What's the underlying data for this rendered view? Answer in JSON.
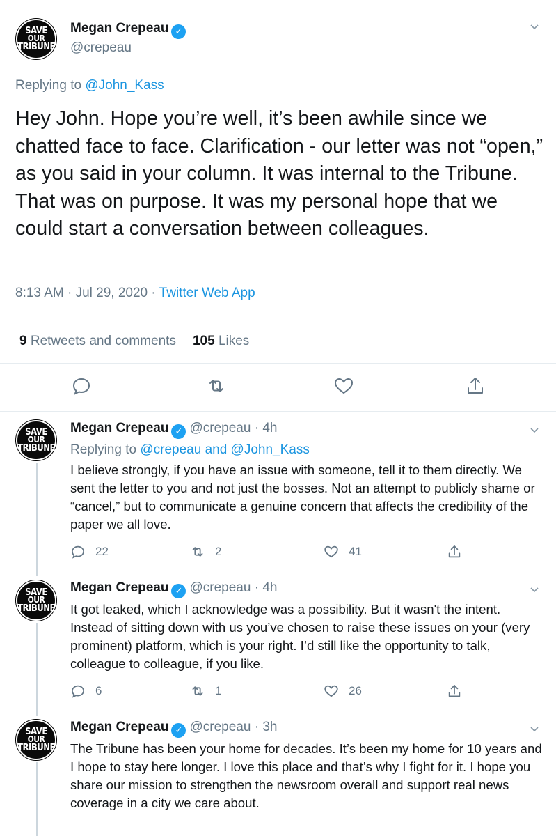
{
  "main_tweet": {
    "avatar_lines": [
      "SAVE",
      "OUR",
      "TRIBUNE"
    ],
    "name": "Megan Crepeau",
    "handle": "@crepeau",
    "replying_prefix": "Replying to ",
    "replying_to": "@John_Kass",
    "text": "Hey John. Hope you’re well, it’s been awhile since we chatted face to face. Clarification - our letter was not “open,” as you said in your column. It was internal to the Tribune. That was on purpose. It was my personal hope that we could start a conversation between colleagues.",
    "timestamp": "8:13 AM · Jul 29, 2020 · ",
    "source": "Twitter Web App",
    "retweets_count": "9",
    "retweets_label": "Retweets and comments",
    "likes_count": "105",
    "likes_label": "Likes"
  },
  "replies": [
    {
      "name": "Megan Crepeau",
      "handle_time": "@crepeau · 4h",
      "replying_prefix": "Replying to ",
      "replying_to": "@crepeau and @John_Kass",
      "text": "I believe strongly, if you have an issue with someone, tell it to them directly. We sent the letter to you and not just the bosses. Not an attempt to publicly shame or “cancel,” but to communicate a genuine concern that affects the credibility of the paper we all love.",
      "replies": "22",
      "retweets": "2",
      "likes": "41"
    },
    {
      "name": "Megan Crepeau",
      "handle_time": "@crepeau · 4h",
      "text": "It got leaked, which I acknowledge was a possibility. But it wasn't the intent. Instead of sitting down with us you’ve chosen to raise these issues on your (very prominent) platform, which is your right. I’d still like the opportunity to talk, colleague to colleague, if you like.",
      "replies": "6",
      "retweets": "1",
      "likes": "26"
    },
    {
      "name": "Megan Crepeau",
      "handle_time": "@crepeau · 3h",
      "text": "The Tribune has been your home for decades. It’s been my home for 10 years and I hope to stay here longer. I love this place and that’s why I fight for it. I hope you share our mission to strengthen the newsroom overall and support real news coverage in a city we care about."
    }
  ],
  "icons": {
    "verified": "verified-badge-icon",
    "more": "chevron-down-icon",
    "reply": "comment-icon",
    "retweet": "retweet-icon",
    "like": "heart-icon",
    "share": "share-icon"
  },
  "colors": {
    "link": "#1b95e0",
    "verified": "#1da1f2",
    "muted": "#657786",
    "divider": "#e6ecf0"
  }
}
